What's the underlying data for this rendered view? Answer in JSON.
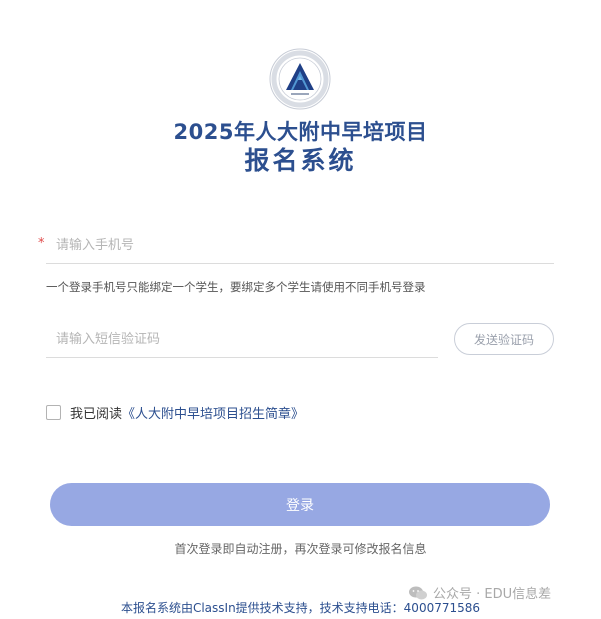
{
  "header": {
    "title_line1": "2025年人大附中早培项目",
    "title_line2": "报名系统"
  },
  "icons": {
    "logo": "school-logo",
    "watermark": "wechat-icon"
  },
  "form": {
    "required_mark": "*",
    "phone_placeholder": "请输入手机号",
    "phone_value": "",
    "hint": "一个登录手机号只能绑定一个学生，要绑定多个学生请使用不同手机号登录",
    "code_placeholder": "请输入短信验证码",
    "code_value": "",
    "send_code_label": "发送验证码",
    "agree_prefix": "我已阅读",
    "agree_link": "《人大附中早培项目招生简章》",
    "login_label": "登录",
    "login_note": "首次登录即自动注册，再次登录可修改报名信息"
  },
  "footer": {
    "support": "本报名系统由ClassIn提供技术支持，技术支持电话：4000771586"
  },
  "watermark": {
    "text": "公众号 · EDU信息差"
  },
  "colors": {
    "brand": "#2c4f8f",
    "login_button": "#97a8e3",
    "required": "#e04a4a"
  }
}
